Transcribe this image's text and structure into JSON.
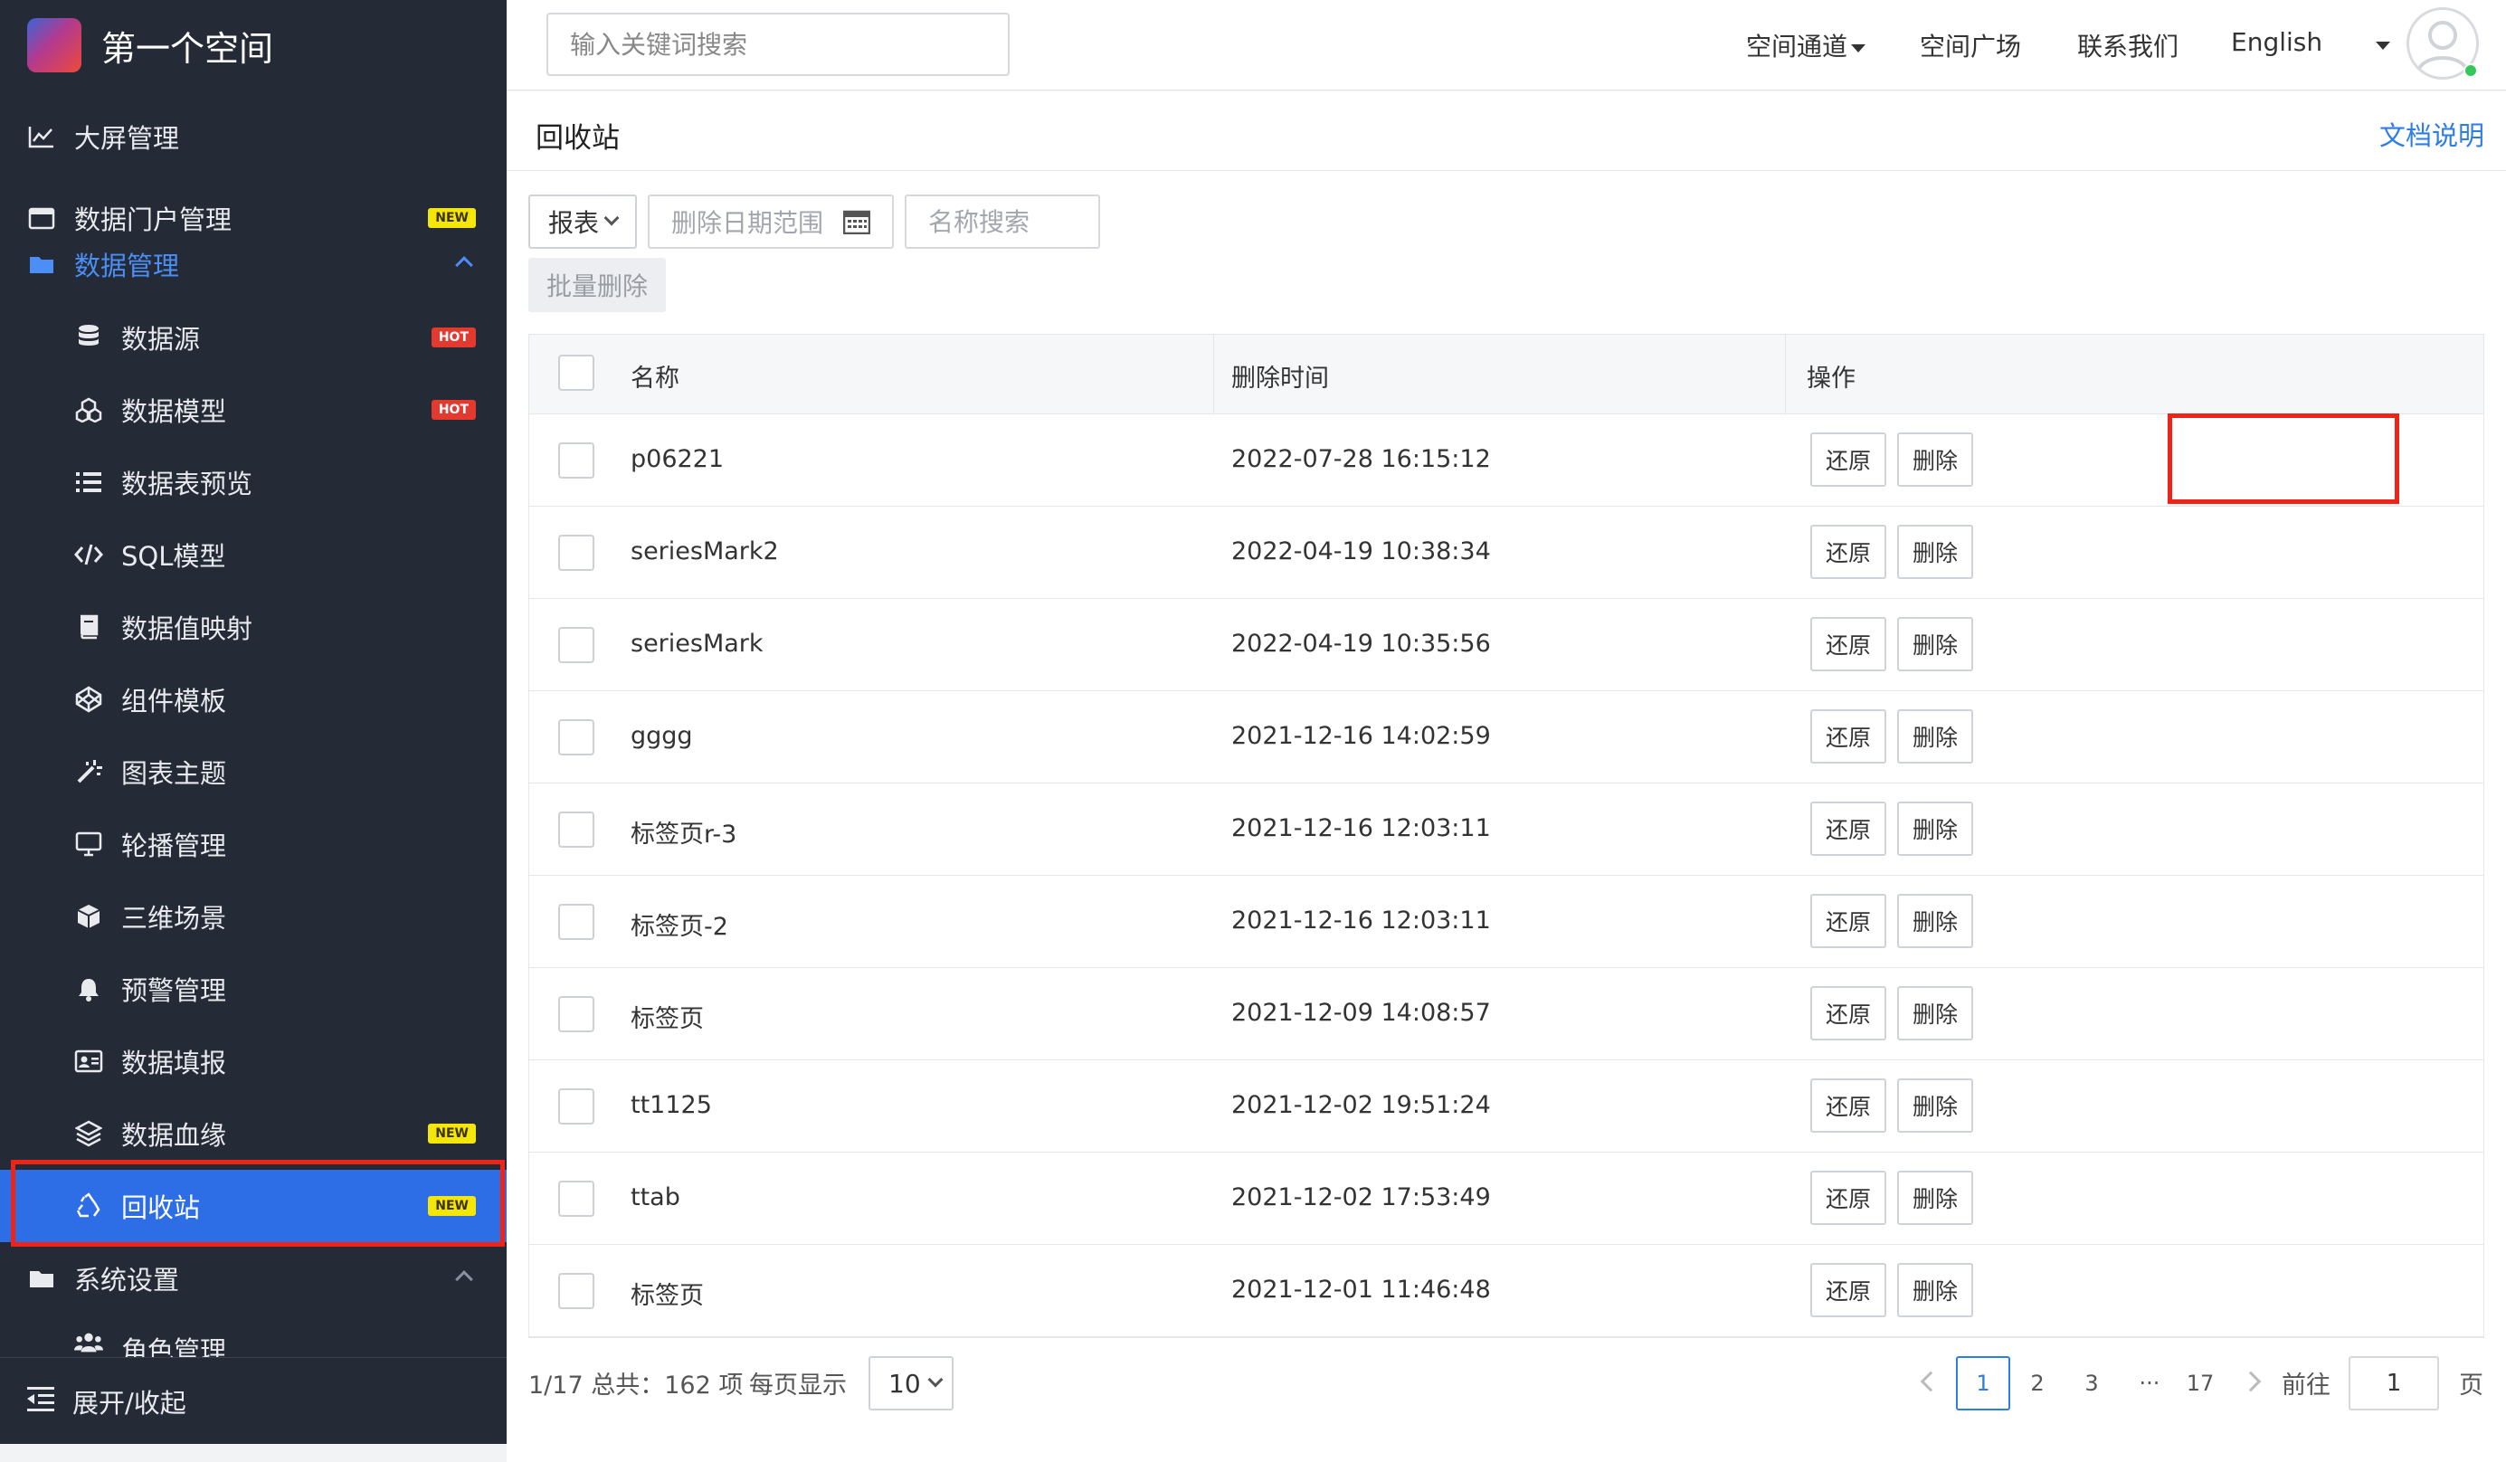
{
  "app": {
    "title": "第一个空间"
  },
  "header": {
    "search_placeholder": "输入关键词搜索",
    "nav": [
      "空间通道",
      "空间广场",
      "联系我们",
      "English"
    ]
  },
  "sidebar": {
    "items": [
      {
        "label": "大屏管理",
        "icon": "line-chart-icon",
        "badge": ""
      },
      {
        "label": "数据门户管理",
        "icon": "browser-window-icon",
        "badge": "NEW"
      },
      {
        "label": "数据管理",
        "icon": "folder-icon",
        "badge": "",
        "expanded": true
      },
      {
        "label": "数据源",
        "icon": "database-icon",
        "badge": "HOT"
      },
      {
        "label": "数据模型",
        "icon": "cubes-icon",
        "badge": "HOT"
      },
      {
        "label": "数据表预览",
        "icon": "list-icon",
        "badge": ""
      },
      {
        "label": "SQL模型",
        "icon": "code-icon",
        "badge": ""
      },
      {
        "label": "数据值映射",
        "icon": "book-icon",
        "badge": ""
      },
      {
        "label": "组件模板",
        "icon": "codepen-icon",
        "badge": ""
      },
      {
        "label": "图表主题",
        "icon": "magic-wand-icon",
        "badge": ""
      },
      {
        "label": "轮播管理",
        "icon": "monitor-icon",
        "badge": ""
      },
      {
        "label": "三维场景",
        "icon": "cube-icon",
        "badge": ""
      },
      {
        "label": "预警管理",
        "icon": "bell-icon",
        "badge": ""
      },
      {
        "label": "数据填报",
        "icon": "id-card-icon",
        "badge": ""
      },
      {
        "label": "数据血缘",
        "icon": "layers-icon",
        "badge": "NEW"
      },
      {
        "label": "回收站",
        "icon": "recycle-icon",
        "badge": "NEW",
        "active": true
      },
      {
        "label": "系统设置",
        "icon": "folder-icon",
        "badge": ""
      },
      {
        "label": "角色管理",
        "icon": "users-icon",
        "badge": ""
      }
    ],
    "footer_label": "展开/收起"
  },
  "page": {
    "title": "回收站",
    "doc_link": "文档说明"
  },
  "filters": {
    "type_select": "报表",
    "date_range_placeholder": "删除日期范围",
    "name_search_placeholder": "名称搜索",
    "batch_delete": "批量删除"
  },
  "table": {
    "columns": [
      "名称",
      "删除时间",
      "操作"
    ],
    "actions": {
      "restore": "还原",
      "delete": "删除"
    },
    "rows": [
      {
        "name": "p06221",
        "deleted_at": "2022-07-28 16:15:12"
      },
      {
        "name": "seriesMark2",
        "deleted_at": "2022-04-19 10:38:34"
      },
      {
        "name": "seriesMark",
        "deleted_at": "2022-04-19 10:35:56"
      },
      {
        "name": "gggg",
        "deleted_at": "2021-12-16 14:02:59"
      },
      {
        "name": "标签页r-3",
        "deleted_at": "2021-12-16 12:03:11"
      },
      {
        "name": "标签页-2",
        "deleted_at": "2021-12-16 12:03:11"
      },
      {
        "name": "标签页",
        "deleted_at": "2021-12-09 14:08:57"
      },
      {
        "name": "tt1125",
        "deleted_at": "2021-12-02 19:51:24"
      },
      {
        "name": "ttab",
        "deleted_at": "2021-12-02 17:53:49"
      },
      {
        "name": "标签页",
        "deleted_at": "2021-12-01 11:46:48"
      }
    ]
  },
  "pagination": {
    "summary": "1/17 总共：162 项",
    "per_page_label": "每页显示",
    "per_page": "10",
    "pages": [
      "1",
      "2",
      "3",
      "···",
      "17"
    ],
    "current": "1",
    "goto_label": "前往",
    "goto_value": "1",
    "page_suffix": "页"
  },
  "colors": {
    "sidebar_bg": "#242a36",
    "active_bg": "#2d6ee6",
    "accent": "#2d7de6",
    "highlight": "#ee2418",
    "badge_new": "#f5e60a",
    "badge_hot": "#e23a2e"
  }
}
